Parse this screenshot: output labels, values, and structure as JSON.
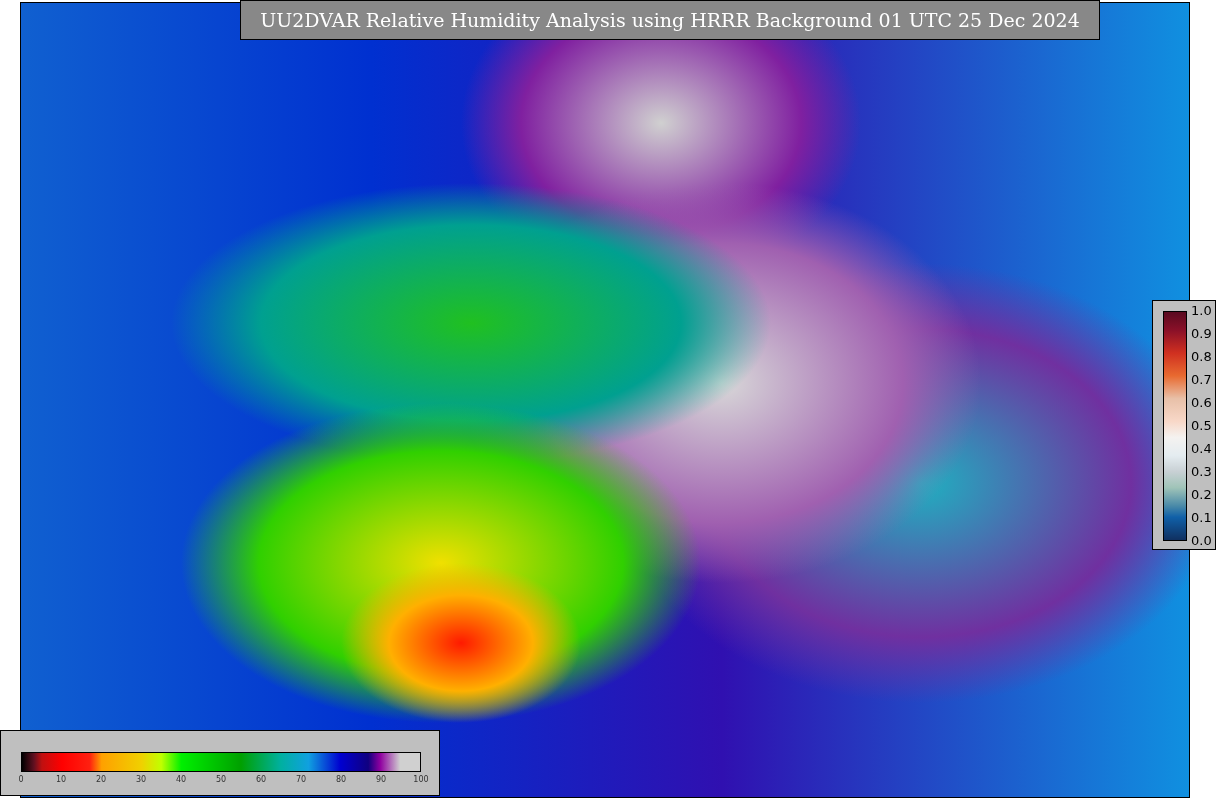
{
  "title": "UU2DVAR Relative Humidity Analysis using HRRR Background 01 UTC 25 Dec 2024",
  "humidity_colorbar": {
    "ticks": [
      "0",
      "10",
      "20",
      "30",
      "40",
      "50",
      "60",
      "70",
      "80",
      "90",
      "100"
    ]
  },
  "observation_colorbar": {
    "ticks": [
      "1.0",
      "0.9",
      "0.8",
      "0.7",
      "0.6",
      "0.5",
      "0.4",
      "0.3",
      "0.2",
      "0.1",
      "0.0"
    ]
  }
}
